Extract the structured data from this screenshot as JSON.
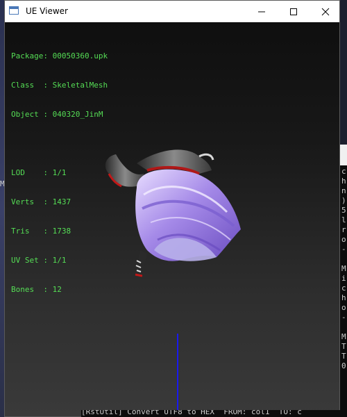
{
  "window": {
    "title": "UE Viewer",
    "controls": {
      "minimize": "—",
      "maximize": "☐",
      "close": "✕"
    }
  },
  "info": {
    "package": {
      "label": "Package:",
      "value": "00050360.upk"
    },
    "class": {
      "label": "Class  :",
      "value": "SkeletalMesh"
    },
    "object": {
      "label": "Object :",
      "value": "040320_JinM"
    },
    "lod": {
      "label": "LOD    :",
      "value": "1/1"
    },
    "verts": {
      "label": "Verts  :",
      "value": "1437"
    },
    "tris": {
      "label": "Tris   :",
      "value": "1738"
    },
    "uvset": {
      "label": "UV Set :",
      "value": "1/1"
    },
    "bones": {
      "label": "Bones  :",
      "value": "12"
    }
  },
  "background": {
    "left_letter": "M",
    "console_lines": [
      "c",
      "h",
      "n",
      ")",
      "5",
      "l",
      "r",
      "o",
      "-",
      "",
      "M",
      "i",
      "c",
      "h",
      "o",
      "-",
      "",
      "M",
      "T",
      "T",
      "0"
    ],
    "status_text": "[RstUtil] Convert UTF8 to HEX  FROM: col1  TO: c"
  },
  "colors": {
    "info_text": "#55dd55",
    "axis": "#1a1aee",
    "hair": "#9b7fe0"
  }
}
